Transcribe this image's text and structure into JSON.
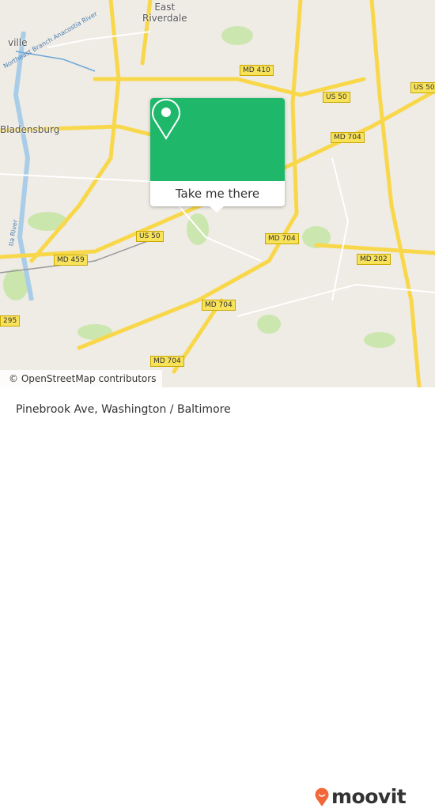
{
  "map": {
    "places": [
      "East\nRiverdale",
      "Bladensburg",
      "ville"
    ],
    "river_labels": [
      "Northeast Branch Anacostia River",
      "tia River"
    ],
    "shields": [
      "MD 410",
      "US 50",
      "US 50",
      "MD 704",
      "MD 704",
      "MD 202",
      "MD 459",
      "US 50",
      "MD 704",
      "MD 704",
      "295"
    ],
    "colors": {
      "land": "#efebe5",
      "park": "#c8e6a8",
      "road_major": "#f8d84a",
      "water": "#a9cde8"
    }
  },
  "popup": {
    "button_label": "Take me there",
    "icon": "map-pin-icon",
    "color": "#1fb86b"
  },
  "attribution": "© OpenStreetMap contributors",
  "footer": {
    "title": "Pinebrook Ave, Washington / Baltimore",
    "logo_text": "moovit",
    "logo_color": "#f2673a"
  }
}
